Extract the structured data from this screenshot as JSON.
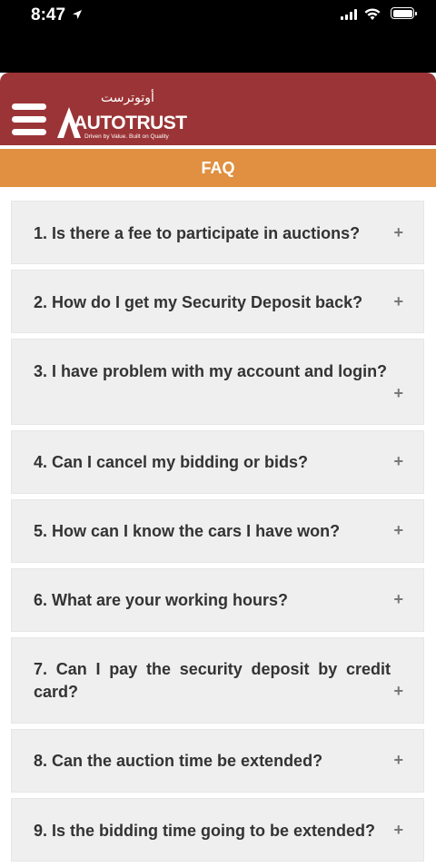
{
  "status_bar": {
    "time": "8:47",
    "icons": [
      "location-arrow-icon",
      "signal-icon",
      "wifi-icon",
      "battery-icon"
    ]
  },
  "header": {
    "logo_arabic": "أوتوترست",
    "logo_text": "AUTOTRUST",
    "logo_tagline": "Driven by Value. Built on Quality",
    "menu_icon": "hamburger-menu-icon"
  },
  "page_title": "FAQ",
  "faq": [
    {
      "question": "1. Is there a fee to participate in auctions?",
      "toggle": "+"
    },
    {
      "question": "2. How do I get my Security Deposit back?",
      "toggle": "+"
    },
    {
      "question": "3. I have problem with my account and login?",
      "toggle": "+"
    },
    {
      "question": "4. Can I cancel my bidding or bids?",
      "toggle": "+"
    },
    {
      "question": "5. How can I know the cars I have won?",
      "toggle": "+"
    },
    {
      "question": "6. What are your working hours?",
      "toggle": "+"
    },
    {
      "question": "7. Can I pay the security deposit by credit card?",
      "toggle": "+"
    },
    {
      "question": "8. Can the auction time be extended?",
      "toggle": "+"
    },
    {
      "question": "9. Is the bidding time going to be extended?",
      "toggle": "+"
    }
  ],
  "colors": {
    "header_red": "#9b3436",
    "faq_bar_orange": "#e09040",
    "item_bg": "#efefef",
    "text_dark": "#333333"
  }
}
